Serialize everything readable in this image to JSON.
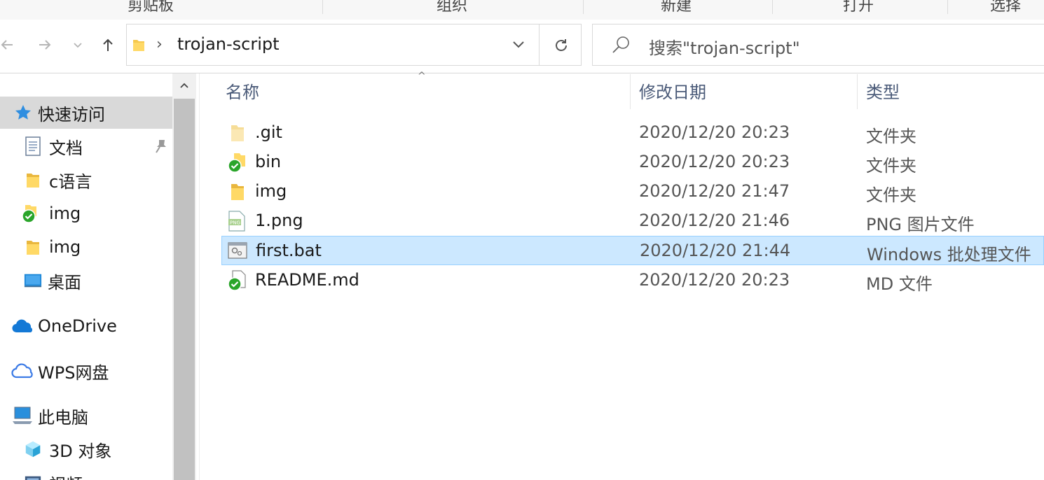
{
  "ribbon": {
    "groups": [
      "剪贴板",
      "组织",
      "新建",
      "打开",
      "选择"
    ]
  },
  "nav": {
    "back_icon": "back-arrow-icon",
    "forward_icon": "forward-arrow-icon",
    "recent_icon": "chevron-down-icon",
    "up_icon": "up-arrow-icon"
  },
  "address": {
    "path": "trojan-script",
    "separator": "›"
  },
  "search": {
    "placeholder": "搜索\"trojan-script\""
  },
  "sidebar": {
    "items": [
      {
        "label": "快速访问",
        "icon": "star-icon"
      },
      {
        "label": "文档",
        "icon": "document-icon"
      },
      {
        "label": "c语言",
        "icon": "folder-icon"
      },
      {
        "label": "img",
        "icon": "synced-folder-icon"
      },
      {
        "label": "img",
        "icon": "folder-icon"
      },
      {
        "label": "桌面",
        "icon": "desktop-icon"
      },
      {
        "label": "OneDrive",
        "icon": "cloud-icon"
      },
      {
        "label": "WPS网盘",
        "icon": "wps-cloud-icon"
      },
      {
        "label": "此电脑",
        "icon": "computer-icon"
      },
      {
        "label": "3D 对象",
        "icon": "cube-icon"
      },
      {
        "label": "视频",
        "icon": "video-icon"
      }
    ]
  },
  "columns": {
    "name": "名称",
    "date": "修改日期",
    "type": "类型"
  },
  "files": [
    {
      "name": ".git",
      "date": "2020/12/20 20:23",
      "type": "文件夹",
      "icon": "folder-icon"
    },
    {
      "name": "bin",
      "date": "2020/12/20 20:23",
      "type": "文件夹",
      "icon": "synced-folder-icon"
    },
    {
      "name": "img",
      "date": "2020/12/20 21:47",
      "type": "文件夹",
      "icon": "folder-icon"
    },
    {
      "name": "1.png",
      "date": "2020/12/20 21:46",
      "type": "PNG 图片文件",
      "icon": "png-file-icon"
    },
    {
      "name": "first.bat",
      "date": "2020/12/20 21:44",
      "type": "Windows 批处理文件",
      "icon": "batch-file-icon"
    },
    {
      "name": "README.md",
      "date": "2020/12/20 20:23",
      "type": "MD 文件",
      "icon": "synced-file-icon"
    }
  ],
  "colors": {
    "selection_bg": "#cce8ff",
    "selection_border": "#99d1ff",
    "header_text": "#4a5a78",
    "folder": "#f6c94e"
  }
}
